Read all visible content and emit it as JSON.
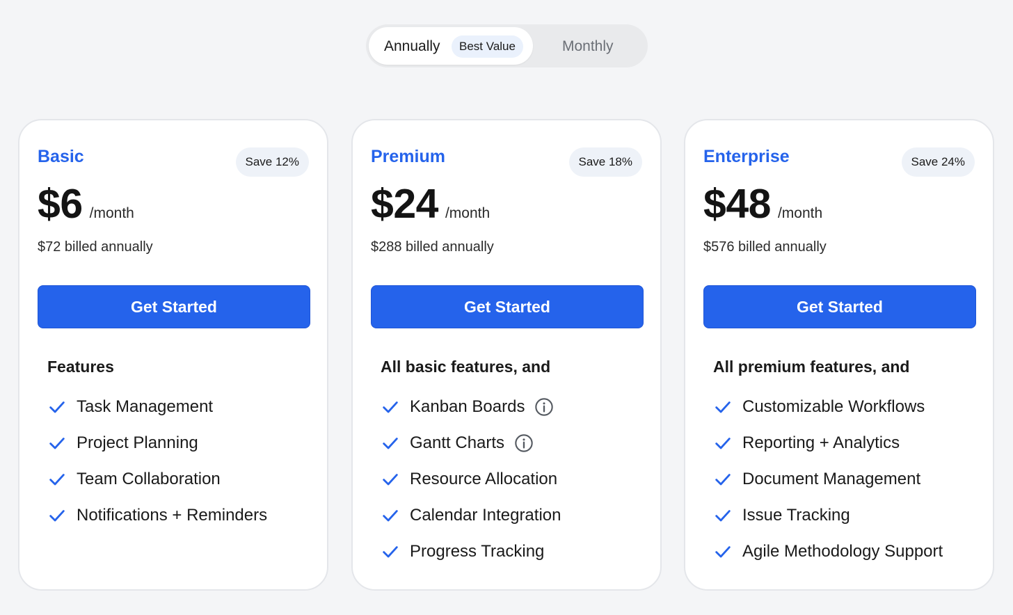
{
  "billing_toggle": {
    "annual_label": "Annually",
    "best_value_badge": "Best Value",
    "monthly_label": "Monthly",
    "selected": "Annually"
  },
  "colors": {
    "accent": "#2563eb",
    "background": "#f4f5f7",
    "card": "#ffffff"
  },
  "plans": [
    {
      "name": "Basic",
      "save_badge": "Save 12%",
      "price": "$6",
      "period": "/month",
      "billed": "$72 billed annually",
      "cta": "Get Started",
      "features_heading": "Features",
      "features": [
        {
          "label": "Task Management",
          "icon": "check-icon"
        },
        {
          "label": "Project Planning",
          "icon": "check-icon"
        },
        {
          "label": "Team Collaboration",
          "icon": "check-icon"
        },
        {
          "label": "Notifications + Reminders",
          "icon": "check-icon"
        }
      ]
    },
    {
      "name": "Premium",
      "save_badge": "Save 18%",
      "price": "$24",
      "period": "/month",
      "billed": "$288 billed annually",
      "cta": "Get Started",
      "features_heading": "All basic features, and",
      "features": [
        {
          "label": "Kanban Boards",
          "icon": "check-icon",
          "info_icon": "info-icon"
        },
        {
          "label": "Gantt Charts",
          "icon": "check-icon",
          "info_icon": "info-icon"
        },
        {
          "label": "Resource Allocation",
          "icon": "check-icon"
        },
        {
          "label": "Calendar Integration",
          "icon": "check-icon"
        },
        {
          "label": "Progress Tracking",
          "icon": "check-icon"
        }
      ]
    },
    {
      "name": "Enterprise",
      "save_badge": "Save 24%",
      "price": "$48",
      "period": "/month",
      "billed": "$576 billed annually",
      "cta": "Get Started",
      "features_heading": "All premium features, and",
      "features": [
        {
          "label": "Customizable Workflows",
          "icon": "check-icon"
        },
        {
          "label": "Reporting + Analytics",
          "icon": "check-icon"
        },
        {
          "label": "Document Management",
          "icon": "check-icon"
        },
        {
          "label": "Issue Tracking",
          "icon": "check-icon"
        },
        {
          "label": "Agile Methodology Support",
          "icon": "check-icon"
        }
      ]
    }
  ]
}
